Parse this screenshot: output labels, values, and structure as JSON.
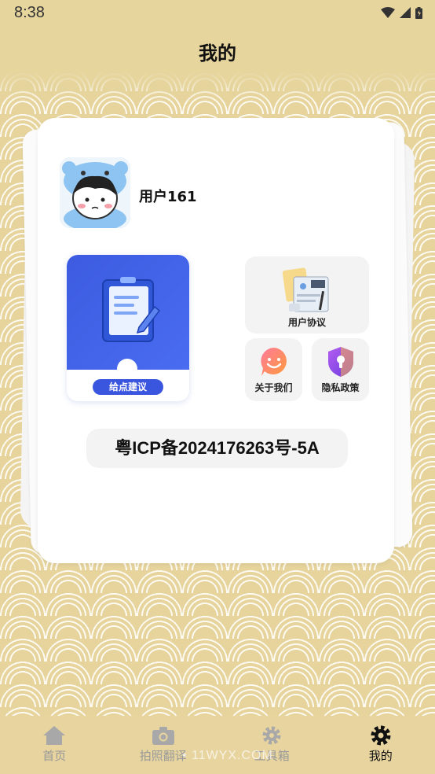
{
  "status_bar": {
    "time": "8:38"
  },
  "header": {
    "title": "我的"
  },
  "profile": {
    "username": "用户161"
  },
  "feedback": {
    "label": "给点建议"
  },
  "tiles": {
    "agreement": "用户协议",
    "about": "关于我们",
    "privacy": "隐私政策"
  },
  "icp": {
    "text": "粤ICP备2024176263号-5A"
  },
  "bottom_nav": {
    "items": [
      {
        "label": "首页",
        "icon": "home-icon"
      },
      {
        "label": "拍照翻译",
        "icon": "camera-icon"
      },
      {
        "label": "工具箱",
        "icon": "gear-icon"
      },
      {
        "label": "我的",
        "icon": "settings-icon"
      }
    ],
    "active": 3
  },
  "watermark": {
    "text": "• 11WYX.COM"
  },
  "colors": {
    "background": "#e6d49c",
    "accent_blue": "#3c5be0",
    "tile_bg": "#f3f3f3"
  }
}
